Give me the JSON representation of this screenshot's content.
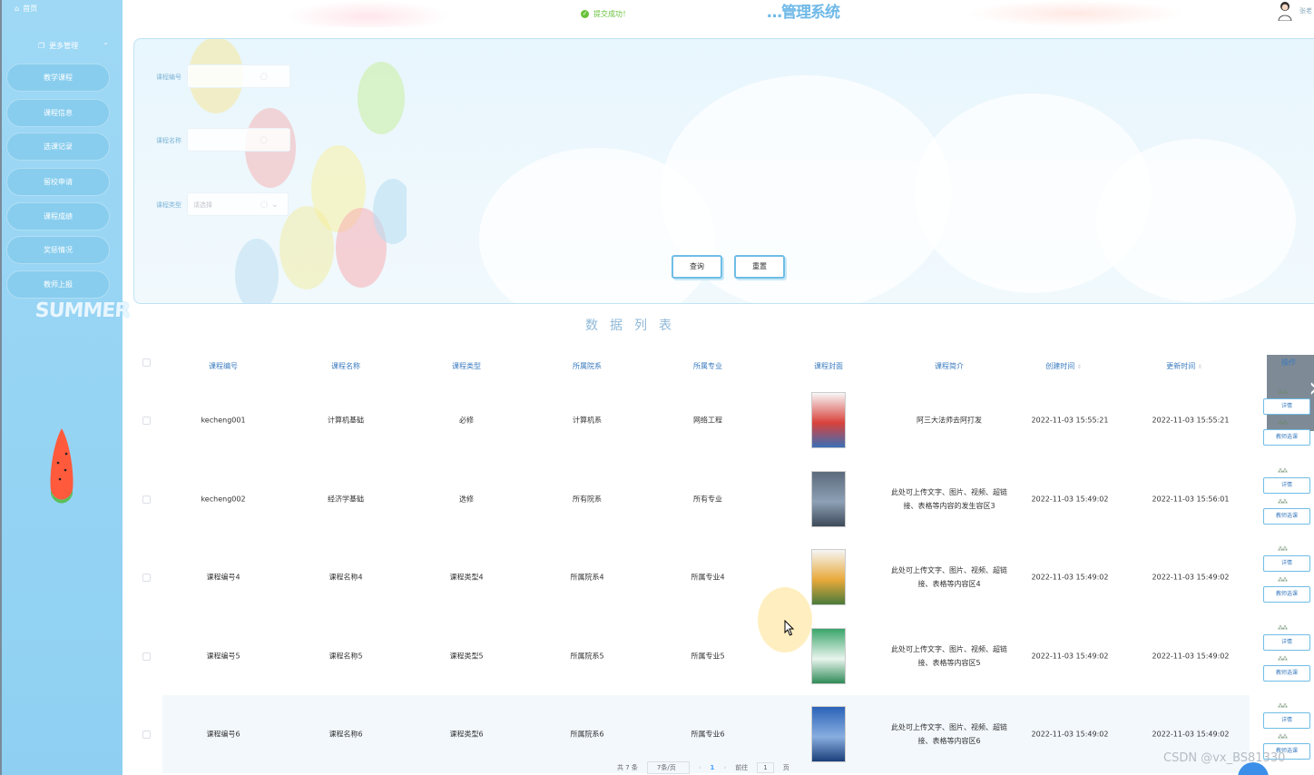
{
  "sidebar": {
    "home_label": "首页",
    "group_label": "更多管理",
    "items": [
      {
        "label": "教学课程"
      },
      {
        "label": "课程信息"
      },
      {
        "label": "选课记录"
      },
      {
        "label": "留校申请"
      },
      {
        "label": "课程成绩"
      },
      {
        "label": "奖惩情况"
      },
      {
        "label": "教师上报"
      }
    ],
    "summer_text": "SUMMER"
  },
  "header": {
    "title": "…管理系统",
    "toast": "提交成功！",
    "username": "张老"
  },
  "search": {
    "fields": [
      {
        "label": "课程编号",
        "placeholder": "",
        "kind": "input"
      },
      {
        "label": "课程名称",
        "placeholder": "",
        "kind": "input"
      },
      {
        "label": "课程类型",
        "placeholder": "请选择",
        "kind": "select"
      }
    ],
    "query_label": "查询",
    "reset_label": "重置"
  },
  "list_title": "数据列表",
  "table": {
    "columns": [
      "课程编号",
      "课程名称",
      "课程类型",
      "所属院系",
      "所属专业",
      "课程封面",
      "课程简介",
      "创建时间",
      "更新时间"
    ],
    "sort_icon": "⇕",
    "ops_header": "操作",
    "rows": [
      {
        "code": "kecheng001",
        "name": "计算机基础",
        "type": "必修",
        "college": "计算机系",
        "major": "网络工程",
        "cover": "cover-1",
        "intro": "阿三大法师去阿打发",
        "created": "2022-11-03 15:55:21",
        "updated": "2022-11-03 15:55:21"
      },
      {
        "code": "kecheng002",
        "name": "经济学基础",
        "type": "选修",
        "college": "所有院系",
        "major": "所有专业",
        "cover": "cover-2",
        "intro": "此处可上传文字、图片、视频、超链接、表格等内容的发生容区3",
        "created": "2022-11-03 15:49:02",
        "updated": "2022-11-03 15:56:01"
      },
      {
        "code": "课程编号4",
        "name": "课程名称4",
        "type": "课程类型4",
        "college": "所属院系4",
        "major": "所属专业4",
        "cover": "cover-3",
        "intro": "此处可上传文字、图片、视频、超链接、表格等内容区4",
        "created": "2022-11-03 15:49:02",
        "updated": "2022-11-03 15:49:02"
      },
      {
        "code": "课程编号5",
        "name": "课程名称5",
        "type": "课程类型5",
        "college": "所属院系5",
        "major": "所属专业5",
        "cover": "cover-4",
        "intro": "此处可上传文字、图片、视频、超链接、表格等内容区5",
        "created": "2022-11-03 15:49:02",
        "updated": "2022-11-03 15:49:02"
      },
      {
        "code": "课程编号6",
        "name": "课程名称6",
        "type": "课程类型6",
        "college": "所属院系6",
        "major": "所属专业6",
        "cover": "cover-5",
        "intro": "此处可上传文字、图片、视频、超链接、表格等内容区6",
        "created": "2022-11-03 15:49:02",
        "updated": "2022-11-03 15:49:02"
      }
    ],
    "op_detail_label": "详情",
    "op_select_label": "教师选课"
  },
  "pager": {
    "total": "共 7 条",
    "size": "7条/页",
    "current": "1",
    "goto_label": "前往",
    "goto_value": "1",
    "page_unit": "页"
  },
  "watermark": "CSDN @vx_BS81330",
  "colors": {
    "sidebar": "#9ed8f5",
    "accent": "#3a7bbf",
    "success": "#67c23a"
  }
}
